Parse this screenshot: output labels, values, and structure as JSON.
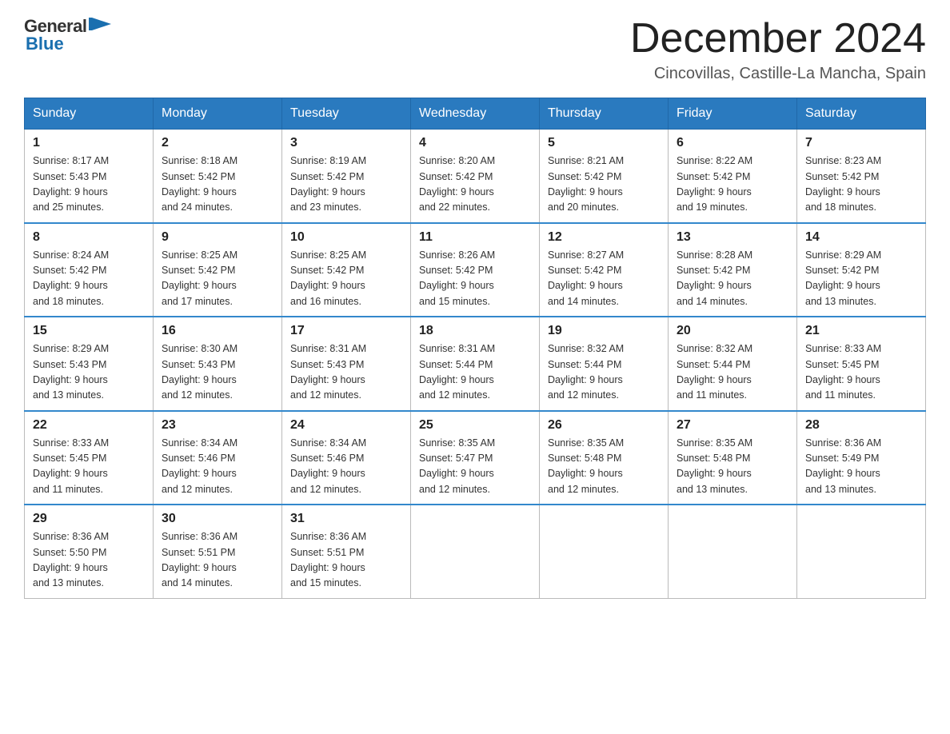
{
  "header": {
    "logo_general": "General",
    "logo_blue": "Blue",
    "month_title": "December 2024",
    "subtitle": "Cincovillas, Castille-La Mancha, Spain"
  },
  "weekdays": [
    "Sunday",
    "Monday",
    "Tuesday",
    "Wednesday",
    "Thursday",
    "Friday",
    "Saturday"
  ],
  "weeks": [
    [
      {
        "day": "1",
        "sunrise": "8:17 AM",
        "sunset": "5:43 PM",
        "daylight": "9 hours and 25 minutes."
      },
      {
        "day": "2",
        "sunrise": "8:18 AM",
        "sunset": "5:42 PM",
        "daylight": "9 hours and 24 minutes."
      },
      {
        "day": "3",
        "sunrise": "8:19 AM",
        "sunset": "5:42 PM",
        "daylight": "9 hours and 23 minutes."
      },
      {
        "day": "4",
        "sunrise": "8:20 AM",
        "sunset": "5:42 PM",
        "daylight": "9 hours and 22 minutes."
      },
      {
        "day": "5",
        "sunrise": "8:21 AM",
        "sunset": "5:42 PM",
        "daylight": "9 hours and 20 minutes."
      },
      {
        "day": "6",
        "sunrise": "8:22 AM",
        "sunset": "5:42 PM",
        "daylight": "9 hours and 19 minutes."
      },
      {
        "day": "7",
        "sunrise": "8:23 AM",
        "sunset": "5:42 PM",
        "daylight": "9 hours and 18 minutes."
      }
    ],
    [
      {
        "day": "8",
        "sunrise": "8:24 AM",
        "sunset": "5:42 PM",
        "daylight": "9 hours and 18 minutes."
      },
      {
        "day": "9",
        "sunrise": "8:25 AM",
        "sunset": "5:42 PM",
        "daylight": "9 hours and 17 minutes."
      },
      {
        "day": "10",
        "sunrise": "8:25 AM",
        "sunset": "5:42 PM",
        "daylight": "9 hours and 16 minutes."
      },
      {
        "day": "11",
        "sunrise": "8:26 AM",
        "sunset": "5:42 PM",
        "daylight": "9 hours and 15 minutes."
      },
      {
        "day": "12",
        "sunrise": "8:27 AM",
        "sunset": "5:42 PM",
        "daylight": "9 hours and 14 minutes."
      },
      {
        "day": "13",
        "sunrise": "8:28 AM",
        "sunset": "5:42 PM",
        "daylight": "9 hours and 14 minutes."
      },
      {
        "day": "14",
        "sunrise": "8:29 AM",
        "sunset": "5:42 PM",
        "daylight": "9 hours and 13 minutes."
      }
    ],
    [
      {
        "day": "15",
        "sunrise": "8:29 AM",
        "sunset": "5:43 PM",
        "daylight": "9 hours and 13 minutes."
      },
      {
        "day": "16",
        "sunrise": "8:30 AM",
        "sunset": "5:43 PM",
        "daylight": "9 hours and 12 minutes."
      },
      {
        "day": "17",
        "sunrise": "8:31 AM",
        "sunset": "5:43 PM",
        "daylight": "9 hours and 12 minutes."
      },
      {
        "day": "18",
        "sunrise": "8:31 AM",
        "sunset": "5:44 PM",
        "daylight": "9 hours and 12 minutes."
      },
      {
        "day": "19",
        "sunrise": "8:32 AM",
        "sunset": "5:44 PM",
        "daylight": "9 hours and 12 minutes."
      },
      {
        "day": "20",
        "sunrise": "8:32 AM",
        "sunset": "5:44 PM",
        "daylight": "9 hours and 11 minutes."
      },
      {
        "day": "21",
        "sunrise": "8:33 AM",
        "sunset": "5:45 PM",
        "daylight": "9 hours and 11 minutes."
      }
    ],
    [
      {
        "day": "22",
        "sunrise": "8:33 AM",
        "sunset": "5:45 PM",
        "daylight": "9 hours and 11 minutes."
      },
      {
        "day": "23",
        "sunrise": "8:34 AM",
        "sunset": "5:46 PM",
        "daylight": "9 hours and 12 minutes."
      },
      {
        "day": "24",
        "sunrise": "8:34 AM",
        "sunset": "5:46 PM",
        "daylight": "9 hours and 12 minutes."
      },
      {
        "day": "25",
        "sunrise": "8:35 AM",
        "sunset": "5:47 PM",
        "daylight": "9 hours and 12 minutes."
      },
      {
        "day": "26",
        "sunrise": "8:35 AM",
        "sunset": "5:48 PM",
        "daylight": "9 hours and 12 minutes."
      },
      {
        "day": "27",
        "sunrise": "8:35 AM",
        "sunset": "5:48 PM",
        "daylight": "9 hours and 13 minutes."
      },
      {
        "day": "28",
        "sunrise": "8:36 AM",
        "sunset": "5:49 PM",
        "daylight": "9 hours and 13 minutes."
      }
    ],
    [
      {
        "day": "29",
        "sunrise": "8:36 AM",
        "sunset": "5:50 PM",
        "daylight": "9 hours and 13 minutes."
      },
      {
        "day": "30",
        "sunrise": "8:36 AM",
        "sunset": "5:51 PM",
        "daylight": "9 hours and 14 minutes."
      },
      {
        "day": "31",
        "sunrise": "8:36 AM",
        "sunset": "5:51 PM",
        "daylight": "9 hours and 15 minutes."
      },
      null,
      null,
      null,
      null
    ]
  ],
  "labels": {
    "sunrise": "Sunrise:",
    "sunset": "Sunset:",
    "daylight": "Daylight:"
  }
}
